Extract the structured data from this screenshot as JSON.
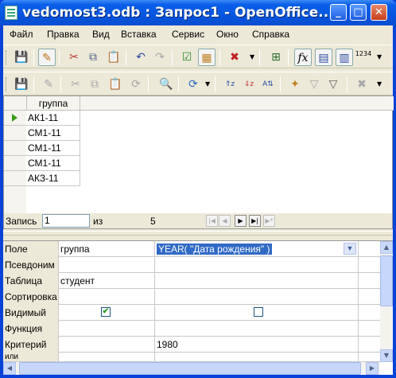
{
  "window": {
    "title": "vedomost3.odb : Запрос1 - OpenOffice....",
    "minimize": "_",
    "maximize": "□",
    "close": "✕"
  },
  "menu": [
    "Файл",
    "Правка",
    "Вид",
    "Вставка",
    "Сервис",
    "Окно",
    "Справка"
  ],
  "toolbar1": {
    "icons": [
      "save-icon",
      "edit-icon",
      "cut-icon",
      "copy-icon",
      "paste-icon",
      "undo-icon",
      "redo-icon",
      "run-query-icon",
      "clear-query-icon",
      "delete-icon",
      "add-table-icon",
      "functions-icon",
      "table-names-icon",
      "alias-icon",
      "distinct-values-icon"
    ],
    "functions_label": "fx",
    "distinct_label": "1234"
  },
  "toolbar2": {
    "icons": [
      "save-record-icon",
      "edit-data-icon",
      "cut-icon",
      "copy-icon",
      "paste-icon",
      "refresh-icon",
      "find-icon",
      "refresh-dropdown-icon",
      "sort-asc-icon",
      "sort-desc-icon",
      "sort-icon",
      "autofilter-icon",
      "apply-filter-icon",
      "standard-filter-icon",
      "remove-filter-icon"
    ]
  },
  "results": {
    "column": "группа",
    "rows": [
      "АК1-11",
      "СМ1-11",
      "СМ1-11",
      "СМ1-11",
      "АКЗ-11"
    ]
  },
  "record_bar": {
    "record_label": "Запись",
    "record_value": "1",
    "of_label": "из",
    "total": "5"
  },
  "design": {
    "row_labels": [
      "Поле",
      "Псевдоним",
      "Таблица",
      "Сортировка",
      "Видимый",
      "Функция",
      "Критерий",
      "или"
    ],
    "col1": {
      "field": "группа",
      "alias": "",
      "table": "студент",
      "sort": "",
      "visible": true,
      "function": "",
      "criterion": ""
    },
    "col2": {
      "field": "YEAR( \"Дата рождения\" )",
      "alias": "",
      "table": "",
      "sort": "",
      "visible": false,
      "function": "",
      "criterion": "1980"
    }
  },
  "colors": {
    "title_bar": "#0655df",
    "selection": "#316ac5",
    "current_row_arrow": "#3c9c1c",
    "checkmark": "#21a121"
  }
}
